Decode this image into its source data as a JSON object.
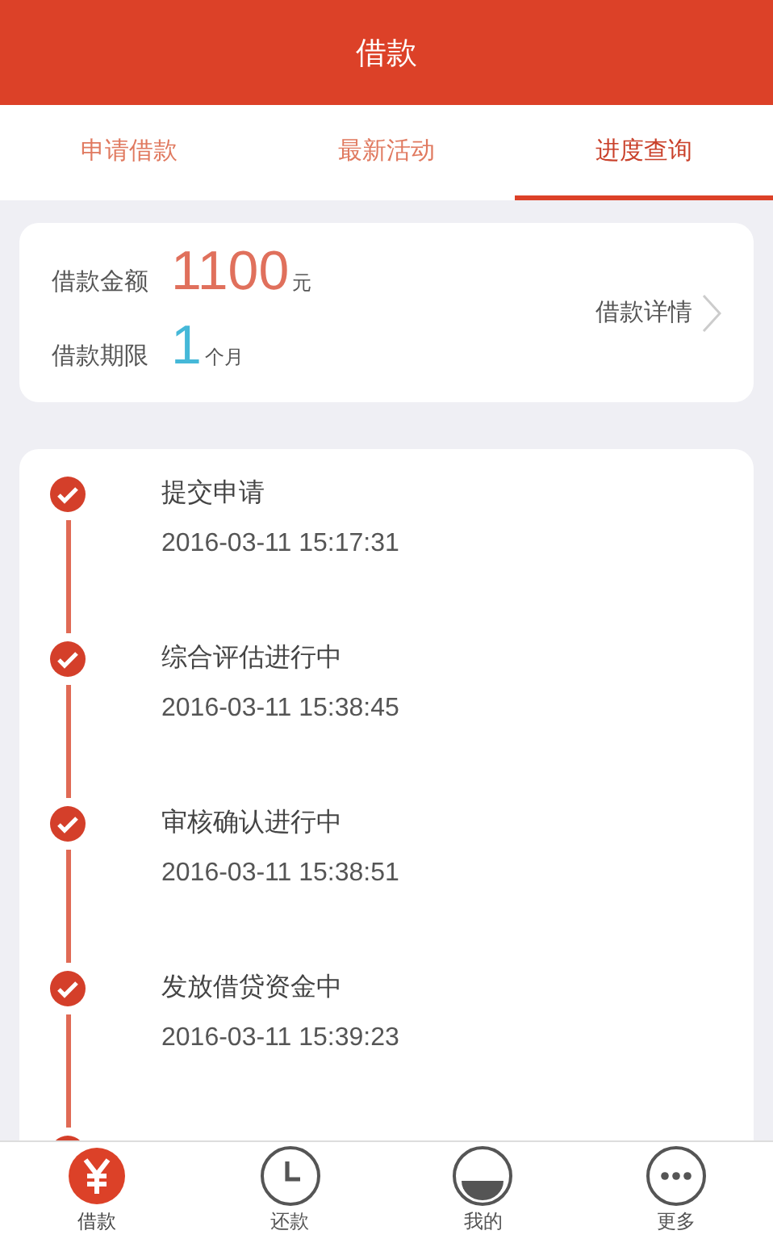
{
  "header": {
    "title": "借款"
  },
  "tabs": [
    {
      "label": "申请借款",
      "selected": false
    },
    {
      "label": "最新活动",
      "selected": false
    },
    {
      "label": "进度查询",
      "selected": true
    }
  ],
  "loan": {
    "amount_label": "借款金额",
    "amount": "1100",
    "amount_unit": "元",
    "term_label": "借款期限",
    "term": "1",
    "term_unit": "个月",
    "details_link": "借款详情"
  },
  "steps": [
    {
      "title": "提交申请",
      "time": "2016-03-11 15:17:31",
      "done": true
    },
    {
      "title": "综合评估进行中",
      "time": "2016-03-11 15:38:45",
      "done": true
    },
    {
      "title": "审核确认进行中",
      "time": "2016-03-11 15:38:51",
      "done": true
    },
    {
      "title": "发放借贷资金中",
      "time": "2016-03-11 15:39:23",
      "done": true
    }
  ],
  "nav": [
    {
      "kind": "yen",
      "label": "借款",
      "selected": true
    },
    {
      "kind": "clock",
      "label": "还款",
      "selected": false
    },
    {
      "kind": "user",
      "label": "我的",
      "selected": false
    },
    {
      "kind": "more",
      "label": "更多",
      "selected": false
    }
  ]
}
